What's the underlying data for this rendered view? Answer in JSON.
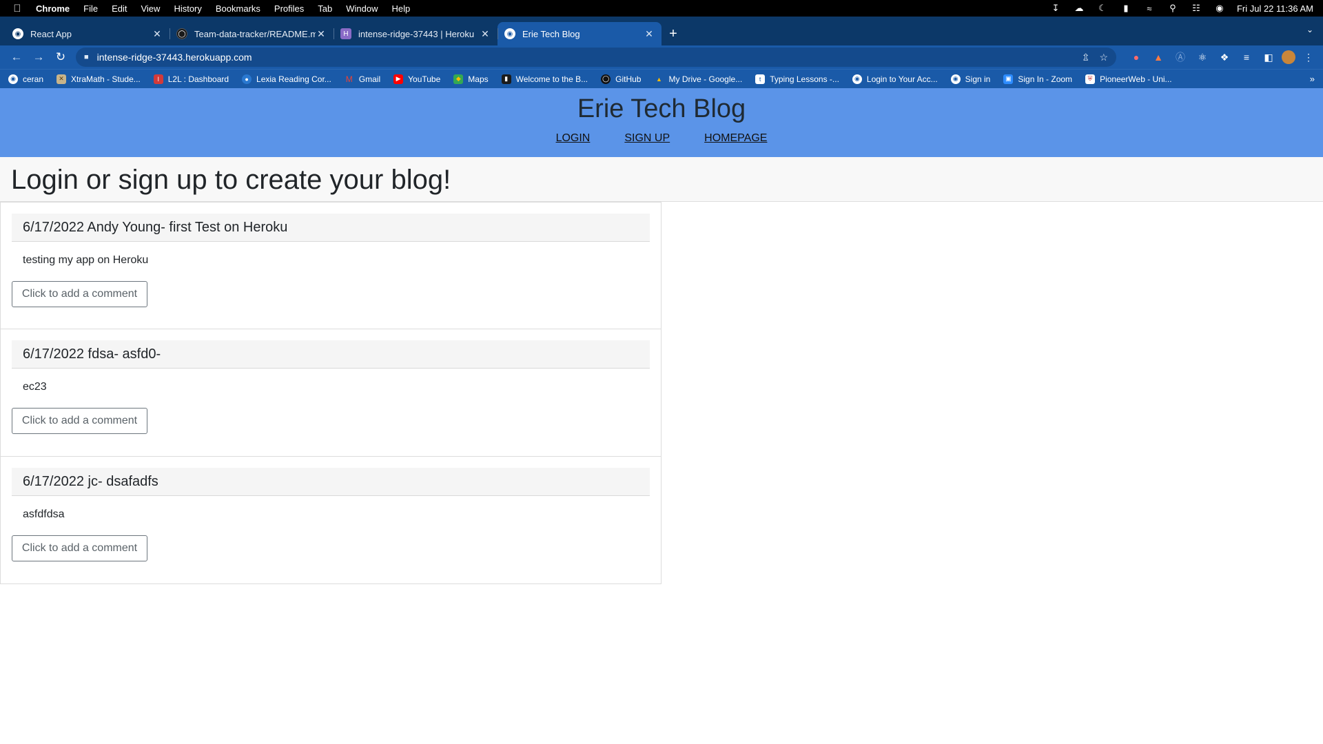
{
  "menubar": {
    "app": "Chrome",
    "items": [
      "File",
      "Edit",
      "View",
      "History",
      "Bookmarks",
      "Profiles",
      "Tab",
      "Window",
      "Help"
    ],
    "datetime": "Fri Jul 22  11:36 AM"
  },
  "tabs": [
    {
      "title": "React App",
      "icon": "globe-icon",
      "active": false
    },
    {
      "title": "Team-data-tracker/README.m",
      "icon": "github-icon",
      "active": false
    },
    {
      "title": "intense-ridge-37443 | Heroku",
      "icon": "heroku-icon",
      "active": false
    },
    {
      "title": "Erie Tech Blog",
      "icon": "globe-icon",
      "active": true
    }
  ],
  "address_bar": {
    "url": "intense-ridge-37443.herokuapp.com"
  },
  "bookmarks": [
    {
      "label": "ceran",
      "icon": "globe-icon"
    },
    {
      "label": "XtraMath - Stude...",
      "icon": "xtramath-icon"
    },
    {
      "label": "L2L : Dashboard",
      "icon": "l2l-icon"
    },
    {
      "label": "Lexia Reading Cor...",
      "icon": "lexia-icon"
    },
    {
      "label": "Gmail",
      "icon": "gmail-icon"
    },
    {
      "label": "YouTube",
      "icon": "youtube-icon"
    },
    {
      "label": "Maps",
      "icon": "maps-icon"
    },
    {
      "label": "Welcome to the B...",
      "icon": "book-icon"
    },
    {
      "label": "GitHub",
      "icon": "github-icon"
    },
    {
      "label": "My Drive - Google...",
      "icon": "drive-icon"
    },
    {
      "label": "Typing Lessons -...",
      "icon": "typing-icon"
    },
    {
      "label": "Login to Your Acc...",
      "icon": "globe-icon"
    },
    {
      "label": "Sign in",
      "icon": "globe-icon"
    },
    {
      "label": "Sign In - Zoom",
      "icon": "zoom-icon"
    },
    {
      "label": "PioneerWeb - Uni...",
      "icon": "shield-icon"
    }
  ],
  "site": {
    "title": "Erie Tech Blog",
    "nav": {
      "login": "LOGIN",
      "signup": "SIGN UP",
      "homepage": "HOMEPAGE"
    },
    "banner": "Login or sign up to create your blog!"
  },
  "posts": [
    {
      "header": "6/17/2022 Andy Young- first Test on Heroku",
      "body": "testing my app on Heroku",
      "comment_label": "Click to add a comment"
    },
    {
      "header": "6/17/2022 fdsa- asfd0-",
      "body": "ec23",
      "comment_label": "Click to add a comment"
    },
    {
      "header": "6/17/2022 jc- dsafadfs",
      "body": "asfdfdsa",
      "comment_label": "Click to add a comment"
    }
  ],
  "colors": {
    "header_bg": "#5b94e8",
    "browser_bg": "#1a5aa8",
    "tabstrip_bg": "#0c3868"
  }
}
